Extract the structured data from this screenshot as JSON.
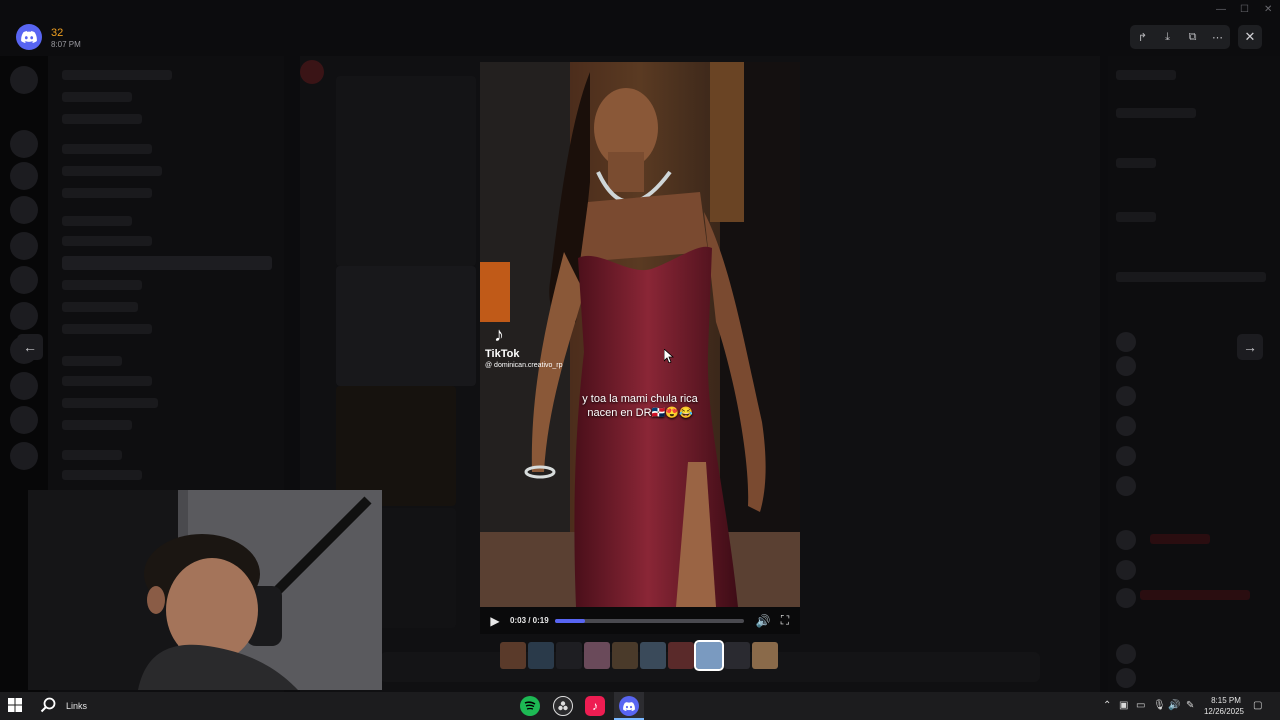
{
  "server_badge": {
    "icon": "discord-icon",
    "count": "32",
    "time": "8:07 PM"
  },
  "video": {
    "time_display": "0:03 / 0:19",
    "progress_fraction": 0.16,
    "watermark_brand": "TikTok",
    "watermark_handle": "@ dominican.creativo_rp",
    "caption_line1": "y toa la mami chula rica",
    "caption_line2": "nacen en DR🇩🇴😍😂",
    "play_icon": "play-icon",
    "volume_icon": "volume-icon",
    "fullscreen_icon": "fullscreen-icon"
  },
  "viewer_toolbar": {
    "icons": [
      "forward-icon",
      "download-icon",
      "open-external-icon",
      "more-icon"
    ],
    "close_icon": "close-icon",
    "prev_icon": "arrow-left-icon",
    "next_icon": "arrow-right-icon"
  },
  "thumbnails": {
    "count": 10,
    "active_index": 7
  },
  "taskbar": {
    "links_label": "Links",
    "clock_time": "8:15 PM",
    "clock_date": "12/26/2025",
    "apps": [
      "spotify-icon",
      "obs-icon",
      "tiktok-icon",
      "discord-icon"
    ]
  },
  "colors": {
    "accent": "#5865f2",
    "taskbar": "#1c1c1e",
    "dress": "#7a1c2c"
  }
}
